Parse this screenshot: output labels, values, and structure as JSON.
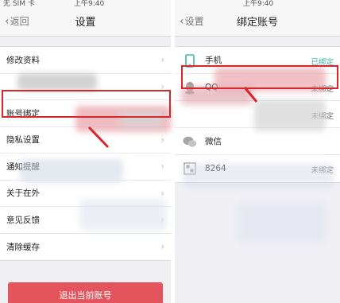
{
  "left": {
    "status_carrier": "无 SIM 卡",
    "status_time": "上午9:40",
    "back_label": "返回",
    "title": "设置",
    "group1": [
      {
        "label": "修改资料"
      },
      {
        "label": ""
      },
      {
        "label": "账号绑定"
      },
      {
        "label": "隐私设置"
      },
      {
        "label": "通知提醒"
      },
      {
        "label": "关于在外"
      },
      {
        "label": "意见反馈"
      },
      {
        "label": "清除缓存"
      }
    ],
    "logout_label": "退出当前账号"
  },
  "right": {
    "status_time": "上午9:40",
    "back_label": "设置",
    "title": "绑定账号",
    "accounts": [
      {
        "label": "手机",
        "state": "已绑定",
        "icon": "phone-icon"
      },
      {
        "label": "QQ",
        "state": "未绑定",
        "icon": "qq-icon"
      },
      {
        "label": "",
        "state": "未绑定",
        "icon": "weibo-icon"
      },
      {
        "label": "微信",
        "state": "",
        "icon": "wechat-icon"
      },
      {
        "label": "8264",
        "state": "未绑定",
        "icon": "8264-icon"
      }
    ]
  },
  "colors": {
    "highlight": "#d9262b",
    "logout": "#e4545c",
    "bound": "#3bb4a4"
  }
}
